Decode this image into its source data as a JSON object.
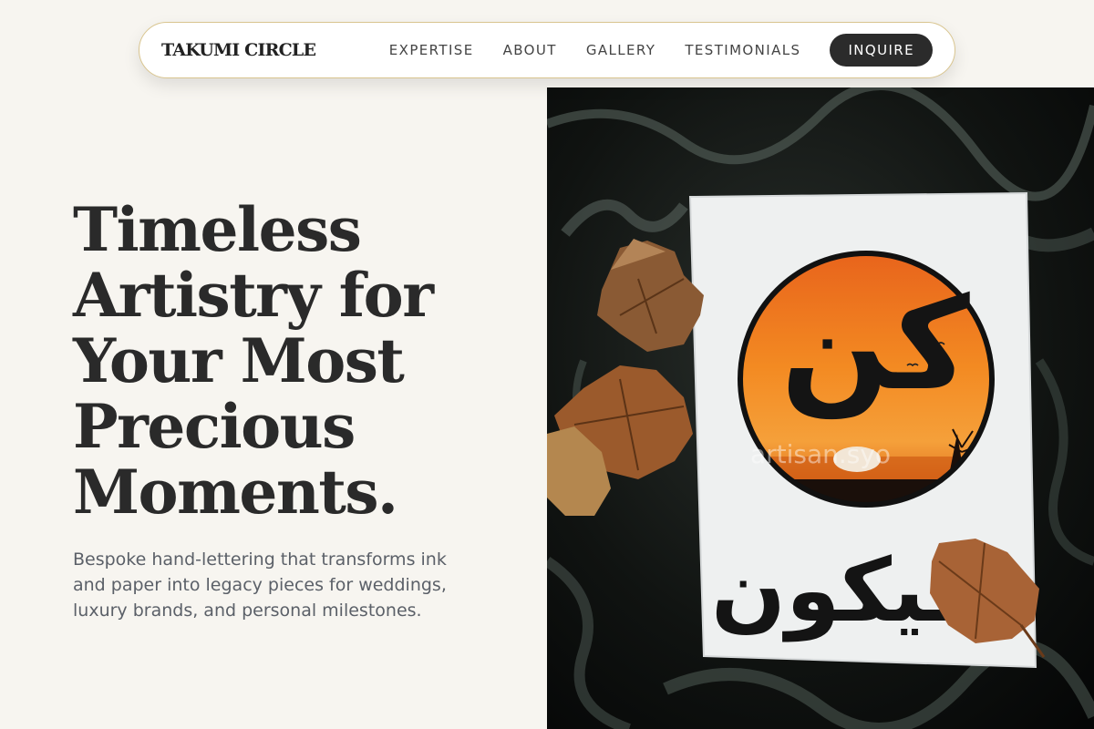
{
  "nav": {
    "logo": "TAKUMI CIRCLE",
    "links": [
      "EXPERTISE",
      "ABOUT",
      "GALLERY",
      "TESTIMONIALS"
    ],
    "cta": "INQUIRE"
  },
  "hero": {
    "title": "Timeless Artistry for Your Most Precious Moments.",
    "subtitle": "Bespoke hand-lettering that transforms ink and paper into legacy pieces for weddings, luxury brands, and personal milestones.",
    "image": {
      "calligraphy_top": "كن",
      "calligraphy_bottom": "فيكون",
      "watermark": "artisan.syo"
    }
  },
  "colors": {
    "background": "#f7f5f0",
    "nav_border": "#d9c58f",
    "cta_background": "#2b2b2b",
    "heading": "#2a2a2a",
    "subtitle": "#5b6068",
    "sunset_orange": "#f07a18"
  }
}
